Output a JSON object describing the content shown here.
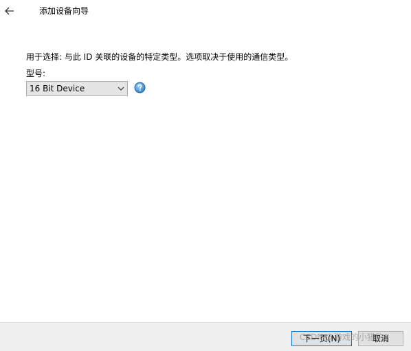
{
  "window": {
    "title": "添加设备向导"
  },
  "content": {
    "description": "用于选择: 与此 ID 关联的设备的特定类型。选项取决于使用的通信类型。",
    "model_label": "型号:",
    "model_select": {
      "value": "16 Bit Device"
    }
  },
  "footer": {
    "next_label": "下一页(N)",
    "cancel_label": "取消"
  },
  "watermark": "CSDN @游戏的小猎豹",
  "colors": {
    "footer_bg": "#f0f0f0",
    "button_bg": "#e1e1e1",
    "default_button_border": "#0078d7",
    "help_icon": "#2f7fc1"
  },
  "icons": {
    "back": "arrow-left-icon",
    "dropdown": "chevron-down-icon",
    "help": "help-icon"
  }
}
